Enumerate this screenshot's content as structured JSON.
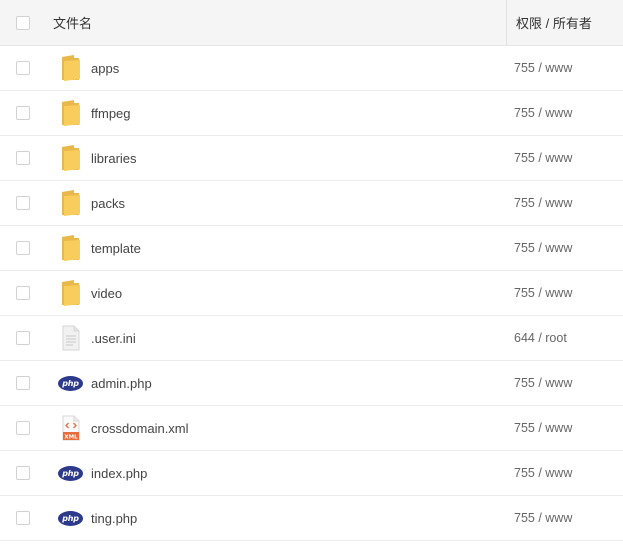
{
  "header": {
    "name_label": "文件名",
    "perm_label": "权限 / 所有者"
  },
  "files": [
    {
      "name": "apps",
      "perm": "755 / www",
      "icon": "folder-icon"
    },
    {
      "name": "ffmpeg",
      "perm": "755 / www",
      "icon": "folder-icon"
    },
    {
      "name": "libraries",
      "perm": "755 / www",
      "icon": "folder-icon"
    },
    {
      "name": "packs",
      "perm": "755 / www",
      "icon": "folder-icon"
    },
    {
      "name": "template",
      "perm": "755 / www",
      "icon": "folder-icon"
    },
    {
      "name": "video",
      "perm": "755 / www",
      "icon": "folder-icon"
    },
    {
      "name": ".user.ini",
      "perm": "644 / root",
      "icon": "text-file-icon"
    },
    {
      "name": "admin.php",
      "perm": "755 / www",
      "icon": "php-file-icon",
      "badge": "php"
    },
    {
      "name": "crossdomain.xml",
      "perm": "755 / www",
      "icon": "xml-file-icon",
      "badge": "XML"
    },
    {
      "name": "index.php",
      "perm": "755 / www",
      "icon": "php-file-icon",
      "badge": "php"
    },
    {
      "name": "ting.php",
      "perm": "755 / www",
      "icon": "php-file-icon",
      "badge": "php"
    }
  ],
  "colors": {
    "folder": "#f8cd5b",
    "php": "#2d3a8c",
    "xml": "#e3703b"
  }
}
